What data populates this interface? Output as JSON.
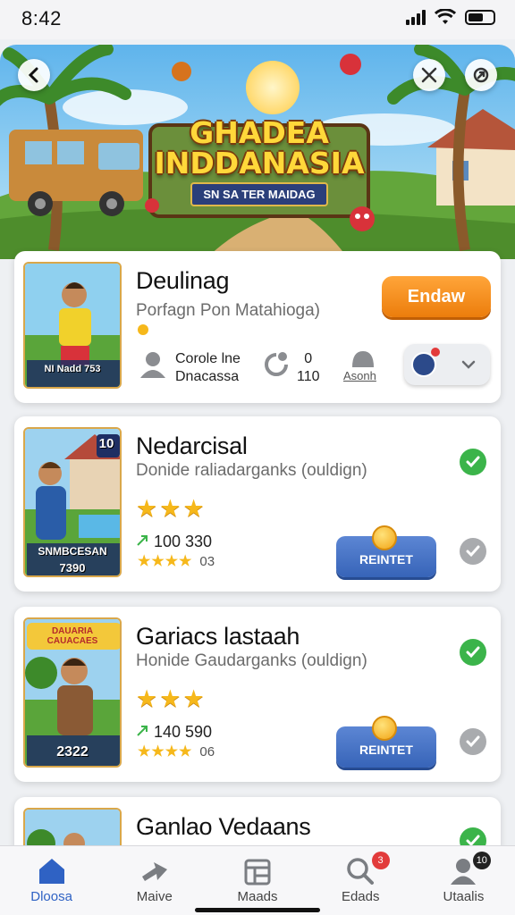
{
  "status": {
    "time": "8:42"
  },
  "hero": {
    "title_line1": "GHADEA",
    "title_line2": "INDDANASIA",
    "subtitle": "SN SA TER MAIDAG"
  },
  "cards": [
    {
      "title": "Deulinag",
      "subtitle": "Porfagn Pon Matahioga)",
      "action_label": "Endaw",
      "meta1_line1": "Corole lne",
      "meta1_line2": "Dnacassa",
      "meta2_line1": "0",
      "meta2_line2": "110",
      "meta3": "Asonh",
      "thumb_label": "NI Nadd 753"
    },
    {
      "title": "Nedarcisal",
      "subtitle": "Donide raliadarganks (ouldign)",
      "stars": 3,
      "stat": "100 330",
      "mini_num": "03",
      "button_label": "REINTET",
      "thumb_label1": "SNMBCESAN",
      "thumb_label2": "7390",
      "thumb_badge": "10"
    },
    {
      "title": "Gariacs lastaah",
      "subtitle": "Honide Gaudarganks (ouldign)",
      "stars": 3,
      "stat": "140 590",
      "mini_num": "06",
      "button_label": "REINTET",
      "thumb_label1": "DAUARIA CAUACAES",
      "thumb_label2": "2322"
    },
    {
      "title": "Ganlao Vedaans"
    }
  ],
  "nav": [
    {
      "label": "Dloosa",
      "icon": "home-icon",
      "active": true
    },
    {
      "label": "Maive",
      "icon": "arrow-icon"
    },
    {
      "label": "Maads",
      "icon": "map-icon"
    },
    {
      "label": "Edads",
      "icon": "search-icon",
      "badge": "3"
    },
    {
      "label": "Utaalis",
      "icon": "profile-icon",
      "badge": "10"
    }
  ],
  "colors": {
    "accent": "#2f62c4",
    "orange": "#f28a12",
    "green": "#3bb44a"
  }
}
